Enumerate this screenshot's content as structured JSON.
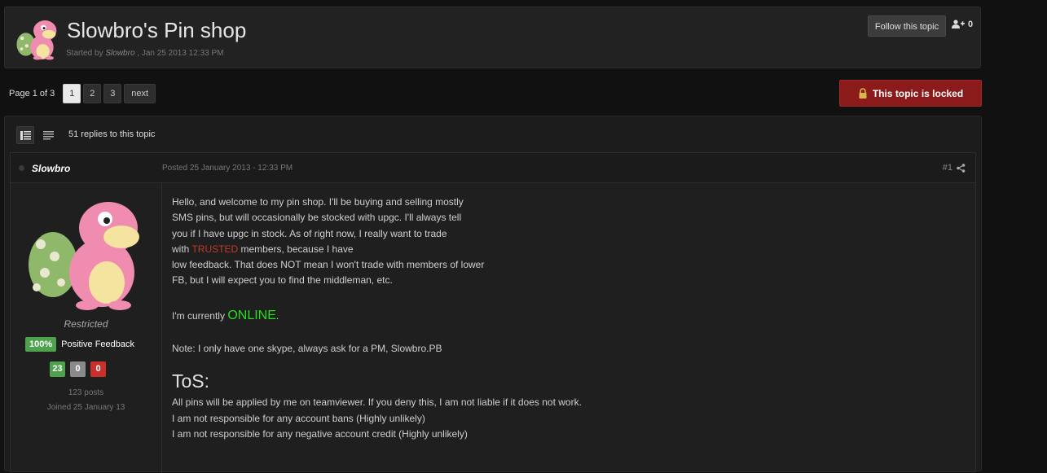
{
  "topic": {
    "title": "Slowbro's Pin shop",
    "started_by_prefix": "Started by",
    "author": "Slowbro",
    "started_date": ", Jan 25 2013 12:33 PM",
    "follow_label": "Follow this topic",
    "follower_count": "0"
  },
  "pagination": {
    "label": "Page 1 of 3",
    "pages": [
      "1",
      "2",
      "3"
    ],
    "next_label": "next"
  },
  "locked": {
    "label": "This topic is locked"
  },
  "posts_panel": {
    "reply_count": "51 replies to this topic"
  },
  "post": {
    "author": "Slowbro",
    "posted": "Posted 25 January 2013 - 12:33 PM",
    "number": "#1",
    "member_title": "Restricted",
    "feedback_pct": "100%",
    "feedback_label": "Positive Feedback",
    "feedback_positive": "23",
    "feedback_neutral": "0",
    "feedback_negative": "0",
    "post_count": "123 posts",
    "joined": "Joined 25 January 13",
    "body": {
      "line1": "Hello, and welcome to my pin shop. I'll be buying and selling mostly",
      "line2": "SMS pins, but will occasionally be stocked with upgc. I'll always tell",
      "line3": "you if I have upgc in stock. As of right now, I really want to trade",
      "line4_before": "with ",
      "line4_trusted": "TRUSTED",
      "line4_after": " members, because I have",
      "line5": "low feedback. That does NOT mean I won't trade with members of lower",
      "line6": "FB, but I will expect you to find the middleman, etc.",
      "online_prefix": "I'm currently ",
      "online_status": "ONLINE",
      "online_suffix": ".",
      "note": "Note: I only have one skype, always ask for a PM, Slowbro.PB",
      "tos_heading": "ToS:",
      "tos1": "All pins will be applied by me on teamviewer. If you deny this, I am not liable if it does not work.",
      "tos2": "I am not responsible for any account bans (Highly unlikely)",
      "tos3": "I am not responsible for any negative account credit (Highly unlikely)"
    }
  },
  "colors": {
    "locked_bg": "#8b1a1a",
    "feedback_green": "#4ea24e",
    "feedback_red": "#c9302c",
    "online_green": "#22e01a",
    "trusted_red": "#c0392b"
  },
  "icons": [
    "slowbro-avatar",
    "user-follow-icon",
    "lock-icon",
    "list-view-icon",
    "text-view-icon",
    "share-icon",
    "online-status-icon"
  ]
}
